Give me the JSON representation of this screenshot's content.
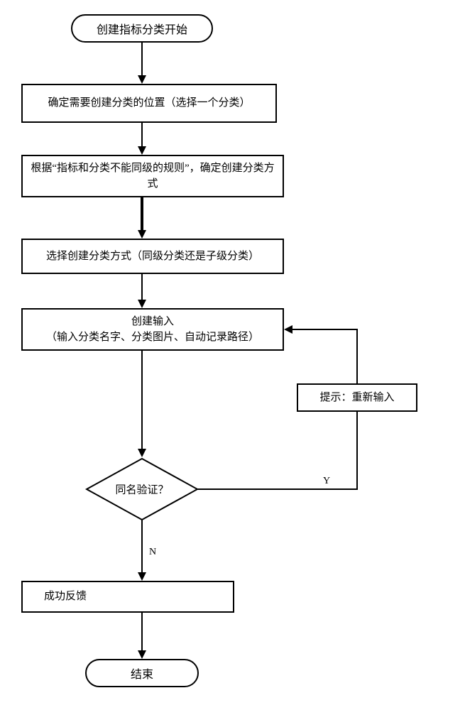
{
  "nodes": {
    "start": "创建指标分类开始",
    "step1": "确定需要创建分类的位置（选择一个分类）",
    "step2": "根据“指标和分类不能同级的规则”，确定创建分类方式",
    "step3": "选择创建分类方式（同级分类还是子级分类）",
    "step4_line1": "创建输入",
    "step4_line2": "（输入分类名字、分类图片、自动记录路径）",
    "reinput": "提示：重新输入",
    "decision": "同名验证？",
    "feedback": "成功反馈",
    "end": "结束"
  },
  "labels": {
    "yes": "Y",
    "no": "N"
  }
}
